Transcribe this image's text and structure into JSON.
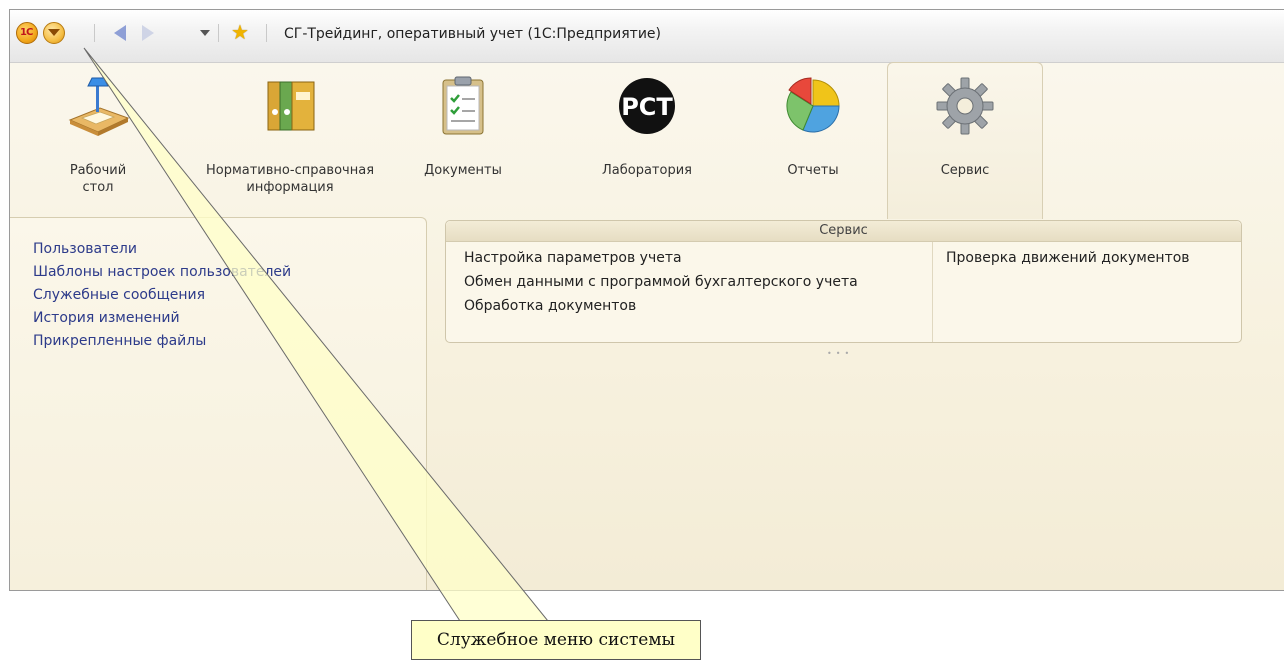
{
  "window": {
    "title": "СГ-Трейдинг, оперативный учет  (1С:Предприятие)"
  },
  "sections": [
    {
      "label": "Рабочий стол",
      "icon": "desk-lamp-icon"
    },
    {
      "label": "Нормативно-справочная информация",
      "icon": "binders-icon"
    },
    {
      "label": "Документы",
      "icon": "clipboard-checklist-icon"
    },
    {
      "label": "Лаборатория",
      "icon": "rst-mark-icon",
      "icon_text": "РСТ"
    },
    {
      "label": "Отчеты",
      "icon": "pie-chart-icon"
    },
    {
      "label": "Сервис",
      "icon": "gear-icon",
      "active": true
    }
  ],
  "nav_panel": {
    "items": [
      "Пользователи",
      "Шаблоны настроек пользователей",
      "Служебные сообщения",
      "История изменений",
      "Прикрепленные файлы"
    ]
  },
  "group": {
    "title": "Сервис",
    "left_commands": [
      "Настройка параметров учета",
      "Обмен данными с программой бухгалтерского учета",
      "Обработка документов"
    ],
    "right_commands": [
      "Проверка движений документов"
    ]
  },
  "callout": {
    "text": "Служебное меню системы"
  },
  "colors": {
    "link": "#2d3b8a",
    "window_bg": "#f7f1de",
    "callout_bg": "#ffffc8"
  }
}
